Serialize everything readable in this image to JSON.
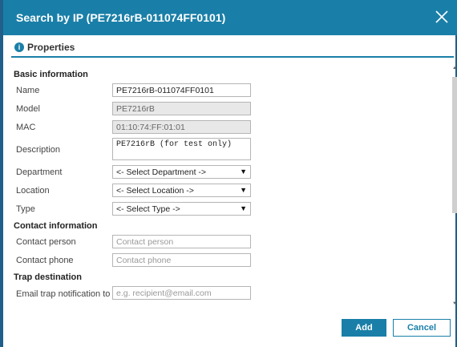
{
  "dialog": {
    "title": "Search by IP (PE7216rB-011074FF0101)",
    "tab": {
      "icon": "info-icon",
      "icon_glyph": "i",
      "title": "Properties"
    }
  },
  "sections": {
    "basic": "Basic information",
    "contact": "Contact information",
    "trap": "Trap destination"
  },
  "labels": {
    "name": "Name",
    "model": "Model",
    "mac": "MAC",
    "description": "Description",
    "department": "Department",
    "location": "Location",
    "type": "Type",
    "contact_person": "Contact person",
    "contact_phone": "Contact phone",
    "email_trap": "Email trap notification to"
  },
  "fields": {
    "name": {
      "value": "PE7216rB-011074FF0101"
    },
    "model": {
      "value": "PE7216rB"
    },
    "mac": {
      "value": "01:10:74:FF:01:01"
    },
    "description": {
      "value": "PE7216rB (for test only)"
    },
    "department": {
      "selected": "<- Select Department ->"
    },
    "location": {
      "selected": "<- Select Location ->"
    },
    "type": {
      "selected": "<- Select Type ->"
    },
    "contact_person": {
      "placeholder": "Contact person"
    },
    "contact_phone": {
      "placeholder": "Contact phone"
    },
    "email_trap": {
      "placeholder": "e.g. recipient@email.com"
    }
  },
  "buttons": {
    "add": "Add",
    "cancel": "Cancel"
  },
  "colors": {
    "accent": "#1a7fa8",
    "frame": "#1f5f8a",
    "readonly_bg": "#e8e8e8"
  }
}
